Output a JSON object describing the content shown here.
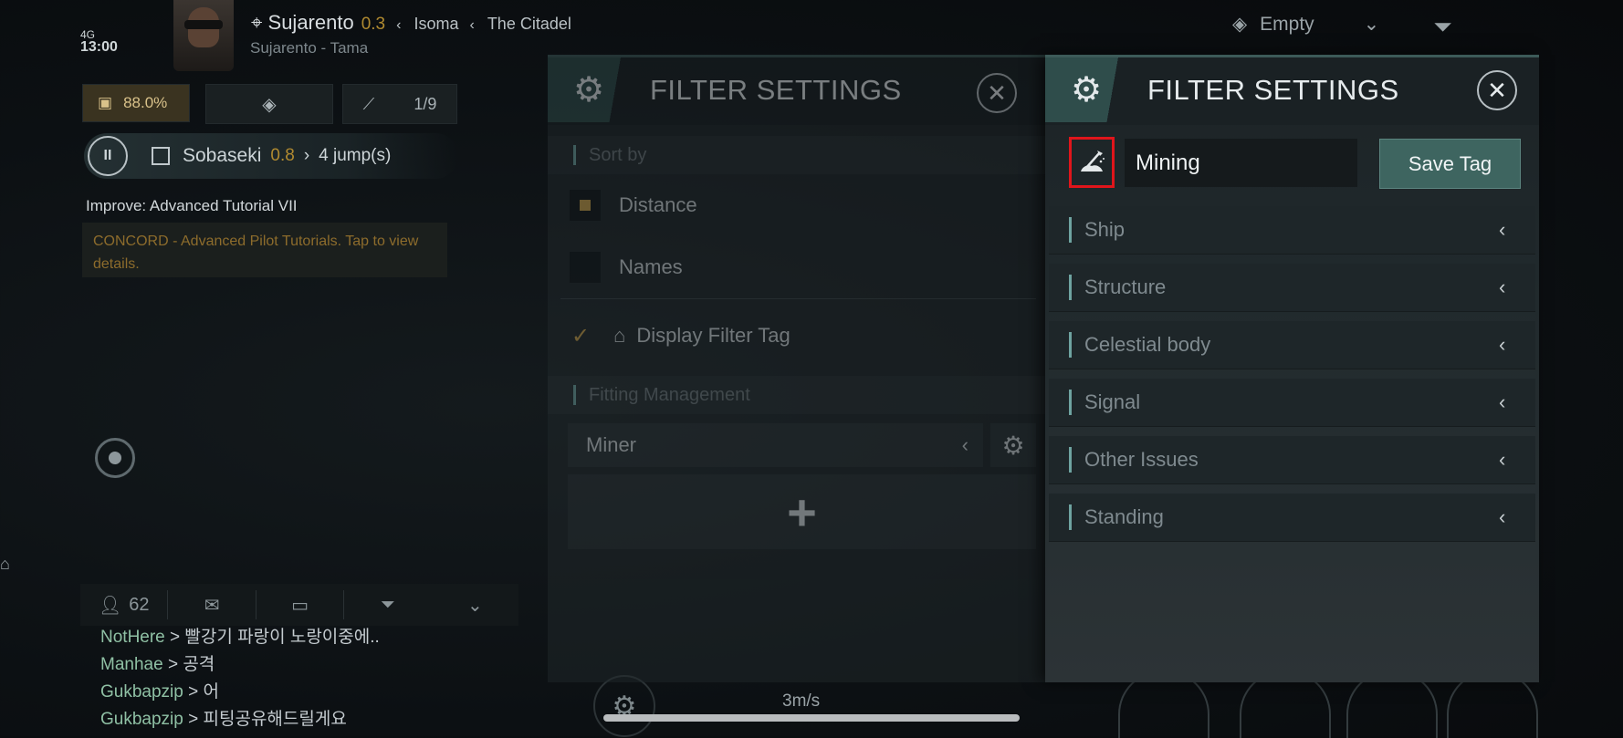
{
  "status": {
    "network": "4G",
    "time": "13:00"
  },
  "location": {
    "system": "Sujarento",
    "security": "0.3",
    "crumbs": [
      "Isoma",
      "The Citadel"
    ],
    "subtitle": "Sujarento - Tama"
  },
  "hud": {
    "cargo_percent": "88.0%",
    "stats_count": "1/9"
  },
  "route": {
    "destination": "Sobaseki",
    "security": "0.8",
    "jumps": "4 jump(s)"
  },
  "mission": {
    "title": "Improve: Advanced Tutorial VII",
    "detail": "CONCORD - Advanced Pilot Tutorials. Tap to view details."
  },
  "chat": {
    "member_count": "62",
    "messages": [
      {
        "name": "NotHere",
        "text": "> 빨강기 파랑이 노랑이중에.."
      },
      {
        "name": "Manhae",
        "text": "> 공격"
      },
      {
        "name": "Gukbapzip",
        "text": "> 어"
      },
      {
        "name": "Gukbapzip",
        "text": "> 피팅공유해드릴게요"
      }
    ]
  },
  "speed": "3m/s",
  "topright": {
    "selector_value": "Empty"
  },
  "back_panel": {
    "title": "FILTER SETTINGS",
    "sort_by_label": "Sort by",
    "options": [
      {
        "label": "Distance",
        "checked": true
      },
      {
        "label": "Names",
        "checked": false
      }
    ],
    "display_filter_tag_label": "Display Filter Tag",
    "fitting_label": "Fitting Management",
    "fitting_selected": "Miner",
    "add_symbol": "+"
  },
  "front_panel": {
    "title": "FILTER SETTINGS",
    "tag_name": "Mining",
    "tag_icon": "mining-icon",
    "save_label": "Save Tag",
    "categories": [
      {
        "label": "Ship"
      },
      {
        "label": "Structure"
      },
      {
        "label": "Celestial body"
      },
      {
        "label": "Signal"
      },
      {
        "label": "Other Issues"
      },
      {
        "label": "Standing"
      }
    ]
  },
  "colors": {
    "accent": "#3e6560",
    "security_warn": "#b08a30",
    "highlight_border": "#e0151b"
  }
}
